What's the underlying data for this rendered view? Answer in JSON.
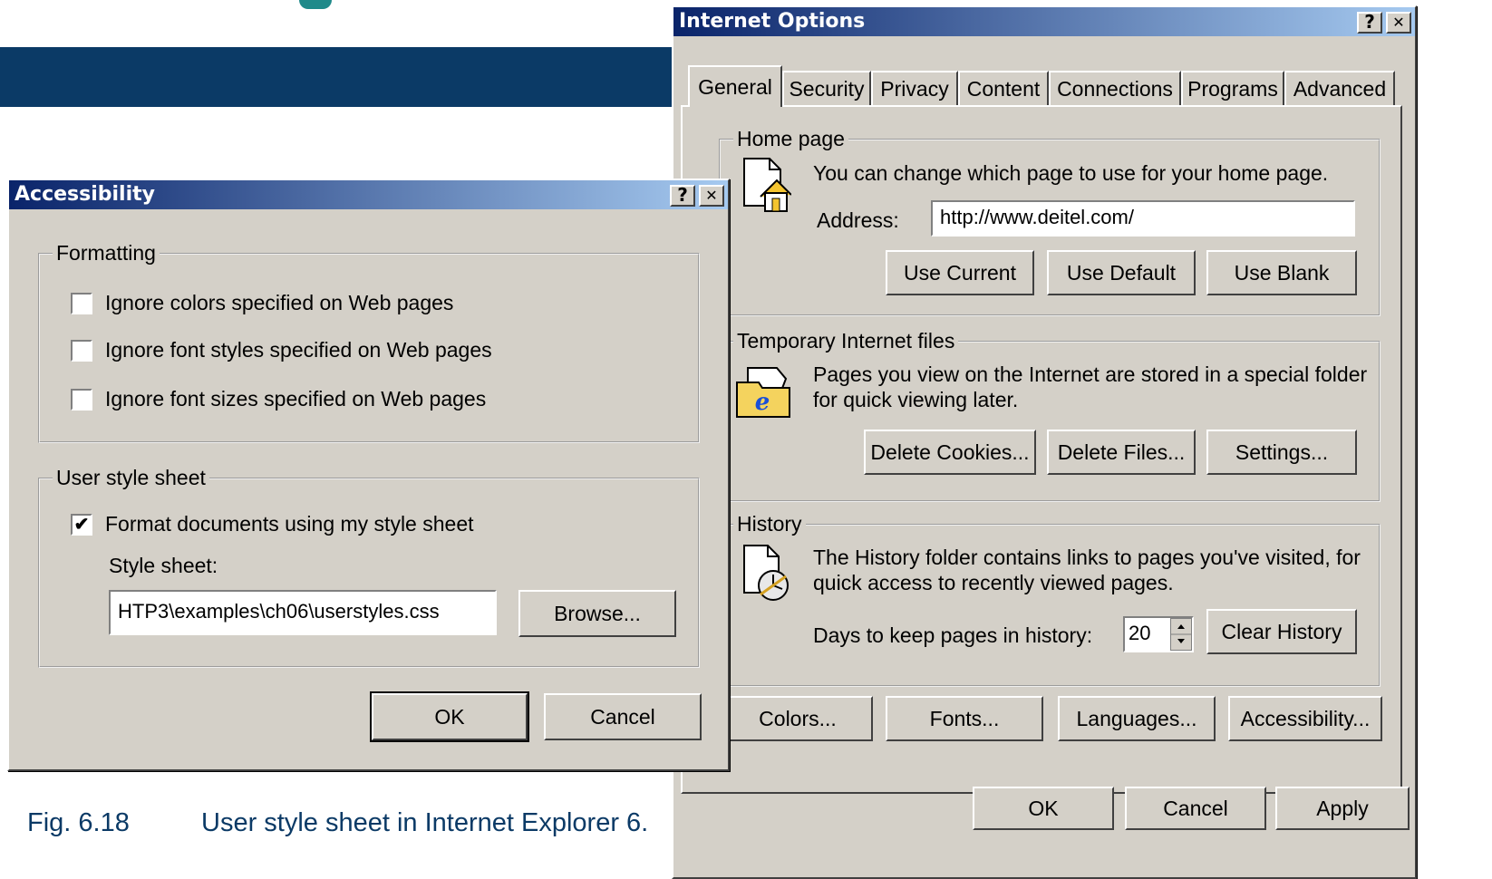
{
  "caption": {
    "fig": "Fig. 6.18",
    "text": "User style sheet in Internet Explorer 6."
  },
  "internet_options": {
    "title": "Internet Options",
    "help": "?",
    "close": "✕",
    "tabs": [
      "General",
      "Security",
      "Privacy",
      "Content",
      "Connections",
      "Programs",
      "Advanced"
    ],
    "home_page": {
      "legend": "Home page",
      "description": "You can change which page to use for your home page.",
      "address_label": "Address:",
      "address_value": "http://www.deitel.com/",
      "use_current": "Use Current",
      "use_default": "Use Default",
      "use_blank": "Use Blank"
    },
    "temp_files": {
      "legend": "Temporary Internet files",
      "description_line1": "Pages you view on the Internet are stored in a special folder",
      "description_line2": "for quick viewing later.",
      "delete_cookies": "Delete Cookies...",
      "delete_files": "Delete Files...",
      "settings": "Settings..."
    },
    "history": {
      "legend": "History",
      "description_line1": "The History folder contains links to pages you've visited, for",
      "description_line2": "quick access to recently viewed pages.",
      "days_label": "Days to keep pages in history:",
      "days_value": "20",
      "clear_history": "Clear History"
    },
    "bottom_buttons": {
      "colors": "Colors...",
      "fonts": "Fonts...",
      "languages": "Languages...",
      "accessibility": "Accessibility..."
    },
    "dialog_buttons": {
      "ok": "OK",
      "cancel": "Cancel",
      "apply": "Apply"
    }
  },
  "accessibility": {
    "title": "Accessibility",
    "help": "?",
    "close": "✕",
    "formatting": {
      "legend": "Formatting",
      "options": [
        {
          "label": "Ignore colors specified on Web pages",
          "checked": false
        },
        {
          "label": "Ignore font styles specified on Web pages",
          "checked": false
        },
        {
          "label": "Ignore font sizes specified on Web pages",
          "checked": false
        }
      ]
    },
    "user_style_sheet": {
      "legend": "User style sheet",
      "format_label": "Format documents using my style sheet",
      "format_checked": true,
      "check_mark": "✔",
      "style_sheet_label": "Style sheet:",
      "style_sheet_value": "HTP3\\examples\\ch06\\userstyles.css",
      "browse": "Browse..."
    },
    "ok": "OK",
    "cancel": "Cancel"
  }
}
